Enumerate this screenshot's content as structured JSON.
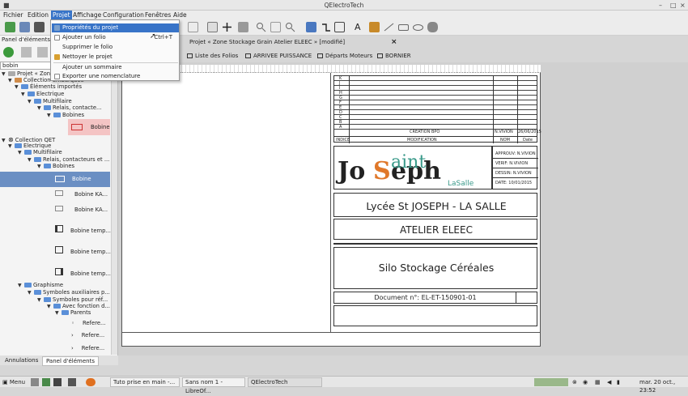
{
  "window": {
    "title": "QElectroTech"
  },
  "menubar": [
    "Fichier",
    "Edition",
    "Projet",
    "Affichage",
    "Configuration",
    "Fenêtres",
    "Aide"
  ],
  "projet_menu": [
    {
      "label": "Propriétés du projet",
      "shortcut": ""
    },
    {
      "label": "Ajouter un folio",
      "shortcut": "Ctrl+T"
    },
    {
      "label": "Supprimer le folio",
      "shortcut": ""
    },
    {
      "label": "Nettoyer le projet",
      "shortcut": ""
    },
    {
      "label": "Ajouter un sommaire",
      "shortcut": ""
    },
    {
      "label": "Exporter une nomenclature",
      "shortcut": ""
    }
  ],
  "panel": {
    "title": "Panel d'éléments",
    "search_value": "bobin",
    "tree": [
      {
        "label": "Projet « Zone"
      },
      {
        "label": "Collection embarquée"
      },
      {
        "label": "Éléments importés"
      },
      {
        "label": "Electrique"
      },
      {
        "label": "Multifilaire"
      },
      {
        "label": "Relais, contacte..."
      },
      {
        "label": "Bobines"
      },
      {
        "label": "Bobine"
      },
      {
        "label": "Collection QET"
      },
      {
        "label": "Electrique"
      },
      {
        "label": "Multifilaire"
      },
      {
        "label": "Relais, contacteurs et ..."
      },
      {
        "label": "Bobines"
      },
      {
        "label": "Bobine"
      },
      {
        "label": "Bobine KA..."
      },
      {
        "label": "Bobine KA..."
      },
      {
        "label": "Bobine temp..."
      },
      {
        "label": "Bobine temp..."
      },
      {
        "label": "Bobine temp..."
      },
      {
        "label": "Graphisme"
      },
      {
        "label": "Symboles auxiliaires p..."
      },
      {
        "label": "Symboles pour réf..."
      },
      {
        "label": "Avec fonction d..."
      },
      {
        "label": "Parents"
      },
      {
        "label": "Refere..."
      },
      {
        "label": "Refere..."
      },
      {
        "label": "Refere..."
      }
    ]
  },
  "bottom_tabs": [
    "Annulations",
    "Panel d'éléments"
  ],
  "document_tab": "Projet « Zone Stockage Grain Atelier ELEEC » [modifié]",
  "folio_tabs": [
    "Liste des Folios",
    "ARRIVEE PUISSANCE",
    "Départs Moteurs",
    "BORNIER"
  ],
  "cartouche": {
    "rev_letters": [
      "K",
      "J",
      "I",
      "H",
      "G",
      "F",
      "E",
      "D",
      "C",
      "B",
      "A"
    ],
    "rev_a": {
      "text": "CREATION BPO",
      "name": "N.VIVION",
      "date": "26/06/2015"
    },
    "rev_header": {
      "indice": "INDICE",
      "modif": "MODIFICATION",
      "nom": "NOM",
      "date": "Date"
    },
    "logo_text": "JoSeph Saint LaSalle",
    "approuv": "APPROUV: N.VIVION",
    "verif": "VERIF: N.VIVION",
    "dessin": "DESSIN: N.VIVION",
    "date": "DATE: 10/01/2015",
    "school": "Lycée St JOSEPH - LA SALLE",
    "atelier": "ATELIER ELEEC",
    "project": "Silo Stockage Céréales",
    "document": "Document n°: EL-ET-150901-01"
  },
  "taskbar": {
    "menu": "Menu",
    "apps": [
      "Tuto prise en main -...",
      "Sans nom 1 - LibreOf...",
      "QElectroTech"
    ],
    "clock": "mar. 20 oct., 23:52"
  },
  "colors": {
    "accent": "#3874c8",
    "selection": "#6b8fc3",
    "folder": "#5a8fd8"
  }
}
